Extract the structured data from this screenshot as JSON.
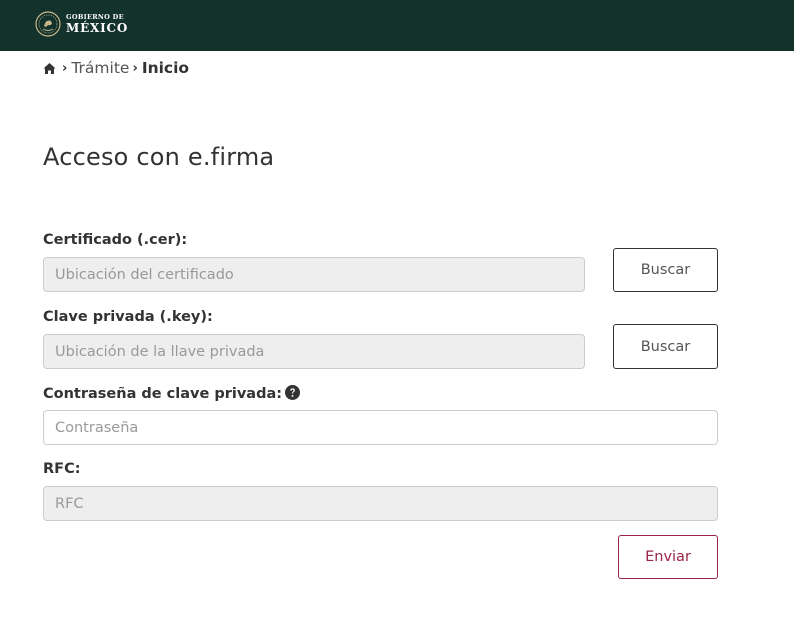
{
  "header": {
    "logo_line1": "GOBIERNO DE",
    "logo_line2": "MÉXICO",
    "background_color": "#13322b"
  },
  "breadcrumb": {
    "home_icon": "home-icon",
    "items": [
      "Trámite",
      "Inicio"
    ],
    "separator": "›"
  },
  "page": {
    "title": "Acceso con e.firma"
  },
  "form": {
    "certificate": {
      "label": "Certificado (.cer):",
      "placeholder": "Ubicación del certificado",
      "button": "Buscar"
    },
    "private_key": {
      "label": "Clave privada (.key):",
      "placeholder": "Ubicación de la llave privada",
      "button": "Buscar"
    },
    "password": {
      "label": "Contraseña de clave privada:",
      "placeholder": "Contraseña",
      "help_icon": "question-circle-icon"
    },
    "rfc": {
      "label": "RFC:",
      "placeholder": "RFC"
    },
    "submit": "Enviar"
  },
  "colors": {
    "accent": "#9d2449",
    "disabled_field": "#eeeeee",
    "text": "#333333"
  }
}
